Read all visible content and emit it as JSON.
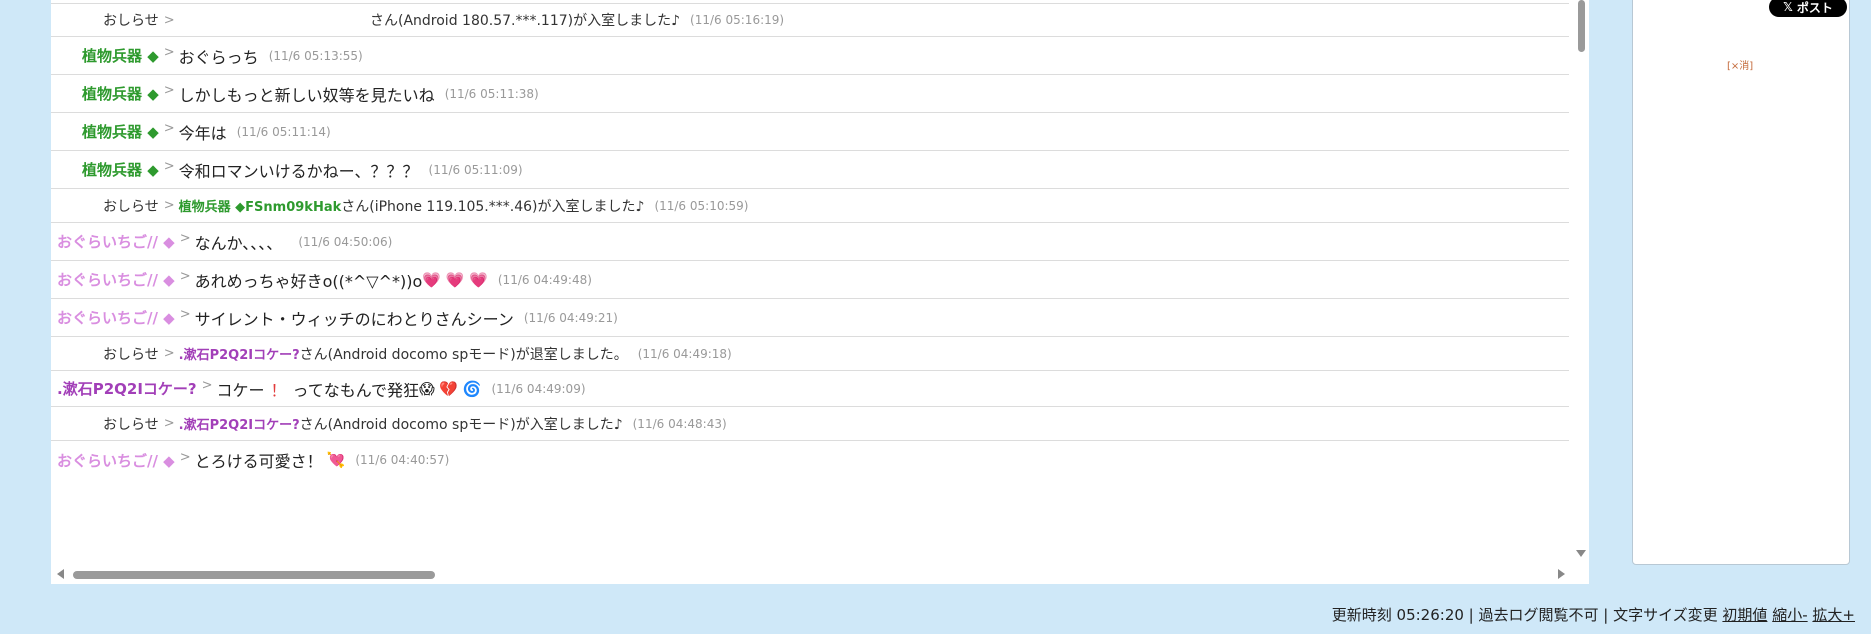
{
  "sep": ">",
  "rows": [
    {
      "speaker": "おしらせ",
      "speaker_sub": "",
      "msg": "さん(Android 180.57.***.117)が入室しました♪",
      "ts": "(11/6 05:16:19)"
    },
    {
      "speaker": "植物兵器 ◆",
      "msg": "おぐらっち",
      "ts": "(11/6 05:13:55)"
    },
    {
      "speaker": "植物兵器 ◆",
      "msg": "しかしもっと新しい奴等を見たいね",
      "ts": "(11/6 05:11:38)"
    },
    {
      "speaker": "植物兵器 ◆",
      "msg": "今年は",
      "ts": "(11/6 05:11:14)"
    },
    {
      "speaker": "植物兵器 ◆",
      "msg": "令和ロマンいけるかねー、？？？",
      "ts": "(11/6 05:11:09)"
    },
    {
      "speaker": "おしらせ",
      "speaker_sub": "植物兵器 ◆FSnm09kHak",
      "msg": "さん(iPhone 119.105.***.46)が入室しました♪",
      "ts": "(11/6 05:10:59)"
    },
    {
      "speaker": "おぐらいちご// ◆",
      "msg": "なんか、、、、",
      "ts": "(11/6 04:50:06)"
    },
    {
      "speaker": "おぐらいちご// ◆",
      "msg": "あれめっちゃ好きo((*^▽^*))o",
      "emoji": "💗 💗 💗",
      "ts": "(11/6 04:49:48)"
    },
    {
      "speaker": "おぐらいちご// ◆",
      "msg": "サイレント・ウィッチのにわとりさんシーン",
      "ts": "(11/6 04:49:21)"
    },
    {
      "speaker": "おしらせ",
      "speaker_sub": ".漱石P2Q2Iコケー?",
      "msg": "さん(Android docomo spモード)が退室しました。",
      "ts": "(11/6 04:49:18)"
    },
    {
      "speaker": ".漱石P2Q2Iコケー?",
      "msg_a": "コケー",
      "msg_b": "！",
      "msg_c": "ってなもんで発狂",
      "emoji": "😱 💔 🌀",
      "ts": "(11/6 04:49:09)"
    },
    {
      "speaker": "おしらせ",
      "speaker_sub": ".漱石P2Q2Iコケー?",
      "msg": "さん(Android docomo spモード)が入室しました♪",
      "ts": "(11/6 04:48:43)"
    },
    {
      "speaker": "おぐらいちご// ◆",
      "msg": "とろける可愛さ！",
      "emoji": "💘",
      "ts": "(11/6 04:40:57)"
    }
  ],
  "side": {
    "x_post_logo": "𝕏",
    "x_post_label": "ポスト",
    "close_label": "[×消]"
  },
  "footer": {
    "update_text": "更新時刻 05:26:20 | 過去ログ閲覧不可 | 文字サイズ変更",
    "reset": "初期値",
    "shrink": "縮小-",
    "enlarge": "拡大+"
  }
}
